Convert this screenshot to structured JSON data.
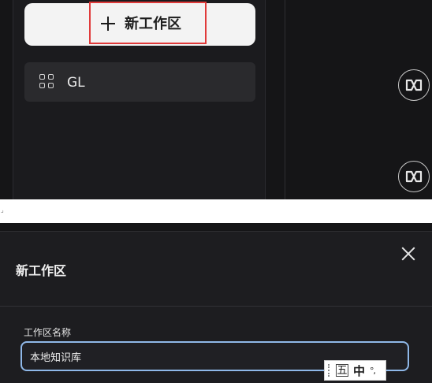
{
  "sidebar": {
    "new_workspace_label": "新工作区",
    "workspaces": [
      {
        "label": "GL"
      }
    ]
  },
  "dialog": {
    "title": "新工作区",
    "field_label": "工作区名称",
    "name_value": "本地知识库"
  },
  "ime": {
    "mode_label": "五",
    "lang_label": "中",
    "punct_label": "°,"
  },
  "colors": {
    "accent_border": "#e03a3a",
    "input_focus": "#8fb8e8",
    "background": "#151517"
  }
}
